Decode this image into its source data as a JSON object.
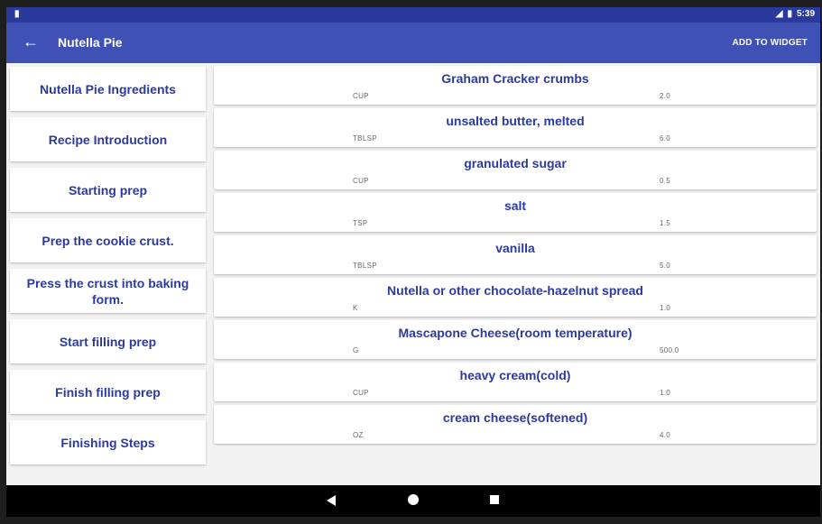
{
  "status_bar": {
    "left_icon": "sd-card-icon",
    "signal_label": "LTE",
    "time": "5:39"
  },
  "app_bar": {
    "title": "Nutella Pie",
    "action_label": "ADD TO WIDGET"
  },
  "steps": [
    {
      "label": "Nutella Pie Ingredients"
    },
    {
      "label": "Recipe Introduction"
    },
    {
      "label": "Starting prep"
    },
    {
      "label": "Prep the cookie crust."
    },
    {
      "label": "Press the crust into baking form."
    },
    {
      "label": "Start filling prep"
    },
    {
      "label": "Finish filling prep"
    },
    {
      "label": "Finishing Steps"
    }
  ],
  "ingredients": [
    {
      "name": "Graham Cracker crumbs",
      "unit": "CUP",
      "qty": "2.0"
    },
    {
      "name": "unsalted butter, melted",
      "unit": "TBLSP",
      "qty": "6.0"
    },
    {
      "name": "granulated sugar",
      "unit": "CUP",
      "qty": "0.5"
    },
    {
      "name": "salt",
      "unit": "TSP",
      "qty": "1.5"
    },
    {
      "name": "vanilla",
      "unit": "TBLSP",
      "qty": "5.0"
    },
    {
      "name": "Nutella or other chocolate-hazelnut spread",
      "unit": "K",
      "qty": "1.0"
    },
    {
      "name": "Mascapone Cheese(room temperature)",
      "unit": "G",
      "qty": "500.0"
    },
    {
      "name": "heavy cream(cold)",
      "unit": "CUP",
      "qty": "1.0"
    },
    {
      "name": "cream cheese(softened)",
      "unit": "OZ",
      "qty": "4.0"
    }
  ],
  "colors": {
    "primary": "#3f51b5",
    "primary_dark": "#2a3a9c",
    "accent_text": "#2b3aa0"
  }
}
